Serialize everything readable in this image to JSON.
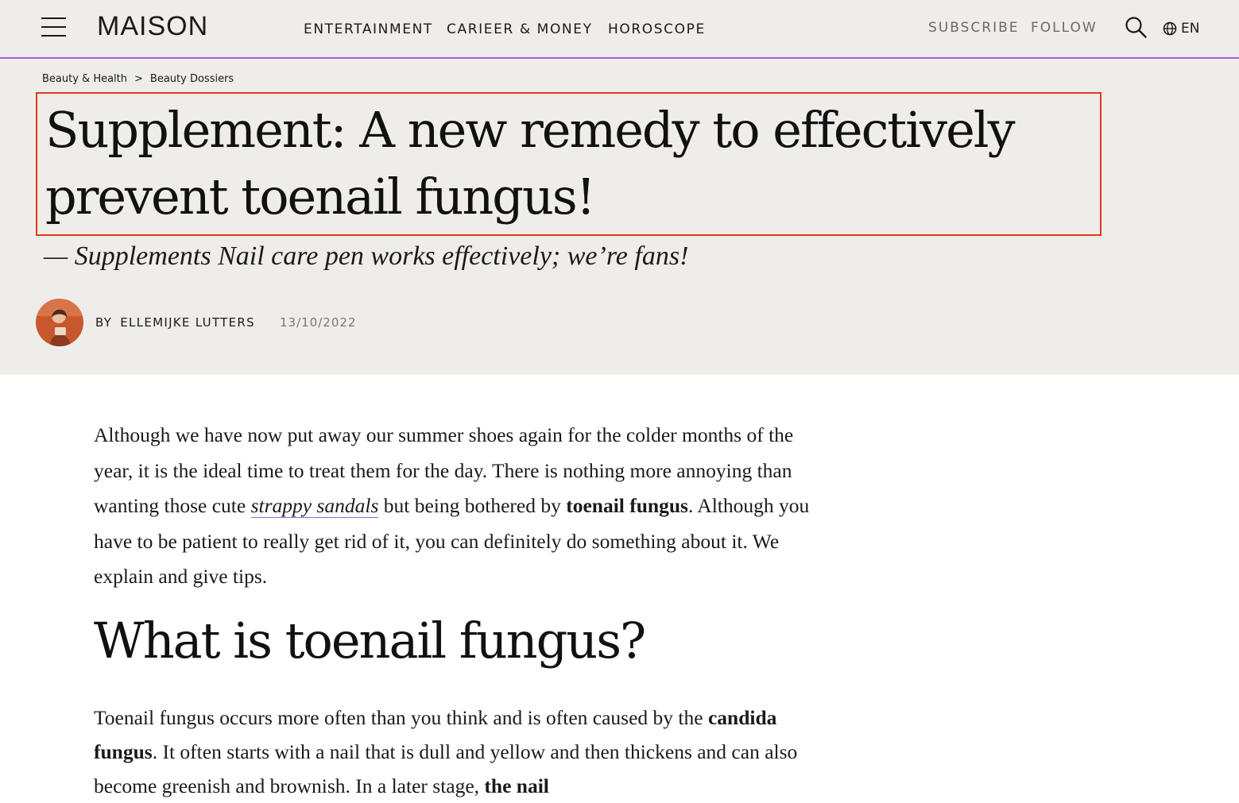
{
  "header": {
    "logo": "MAISON",
    "nav": [
      "ENTERTAINMENT",
      "CARIEER & MONEY",
      "HOROSCOPE"
    ],
    "subscribe": "SUBSCRIBE",
    "follow": "FOLLOW",
    "language": "EN"
  },
  "breadcrumb": [
    "Beauty & Health",
    "Beauty Dossiers"
  ],
  "article": {
    "title_line1": "Supplement: A new remedy to effectively",
    "title_line2": "prevent toenail fungus!",
    "subtitle": "— Supplements Nail care pen works effectively; we’re fans!",
    "by_label": "BY",
    "author": "ELLEMIJKE LUTTERS",
    "date": "13/10/2022"
  },
  "body": {
    "p1": {
      "t1": "Although we have now put away our summer shoes again for the colder months of the year, it is the ideal time to treat them for the day. There is nothing more annoying than wanting those cute ",
      "link": "strappy sandals",
      "t2": " but being bothered by ",
      "bold": "toenail fungus",
      "t3": ". Although you have to be patient to really get rid of it, you can definitely do something about it. We explain and give tips."
    },
    "heading": "What is toenail fungus?",
    "p2": {
      "t1": "Toenail fungus occurs more often than you think and is often caused by the ",
      "bold1": "candida fungus",
      "t2": ". It often starts with a nail that is dull and yellow and then thickens and can also become greenish and brownish. In a later stage, ",
      "bold2": "the nail"
    }
  },
  "colors": {
    "accent": "#a65fd1",
    "highlight_box": "#e03a1e",
    "hero_bg": "#efedea"
  },
  "icons": [
    "menu-icon",
    "search-icon",
    "globe-icon"
  ]
}
